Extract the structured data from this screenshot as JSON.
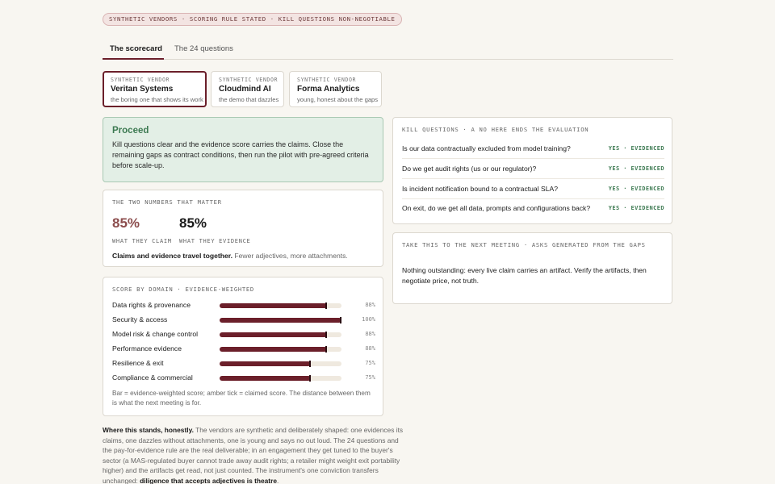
{
  "banner": "SYNTHETIC VENDORS · SCORING RULE STATED · KILL QUESTIONS NON-NEGOTIABLE",
  "tabs": [
    {
      "label": "The scorecard",
      "active": true
    },
    {
      "label": "The 24 questions",
      "active": false
    }
  ],
  "vendors": [
    {
      "tag": "SYNTHETIC VENDOR",
      "name": "Veritan Systems",
      "sub": "the boring one that shows its work",
      "active": true
    },
    {
      "tag": "SYNTHETIC VENDOR",
      "name": "Cloudmind AI",
      "sub": "the demo that dazzles",
      "active": false
    },
    {
      "tag": "SYNTHETIC VENDOR",
      "name": "Forma Analytics",
      "sub": "young, honest about the gaps",
      "active": false
    }
  ],
  "verdict": {
    "title": "Proceed",
    "text": "Kill questions clear and the evidence score carries the claims. Close the remaining gaps as contract conditions, then run the pilot with pre-agreed criteria before scale-up."
  },
  "numbers": {
    "label": "THE TWO NUMBERS THAT MATTER",
    "claim_value": "85%",
    "claim_label": "WHAT THEY CLAIM",
    "evidence_value": "85%",
    "evidence_label": "WHAT THEY EVIDENCE",
    "note_bold": "Claims and evidence travel together.",
    "note_rest": " Fewer adjectives, more attachments."
  },
  "domains": {
    "label": "SCORE BY DOMAIN · EVIDENCE-WEIGHTED",
    "items": [
      {
        "name": "Data rights & provenance",
        "pct": "88%",
        "evidence": 88,
        "claimed": 88
      },
      {
        "name": "Security & access",
        "pct": "100%",
        "evidence": 100,
        "claimed": 100
      },
      {
        "name": "Model risk & change control",
        "pct": "88%",
        "evidence": 88,
        "claimed": 88
      },
      {
        "name": "Performance evidence",
        "pct": "88%",
        "evidence": 88,
        "claimed": 88
      },
      {
        "name": "Resilience & exit",
        "pct": "75%",
        "evidence": 75,
        "claimed": 75
      },
      {
        "name": "Compliance & commercial",
        "pct": "75%",
        "evidence": 75,
        "claimed": 75
      }
    ],
    "note": "Bar = evidence-weighted score; amber tick = claimed score. The distance between them is what the next meeting is for."
  },
  "honest": {
    "lead": "Where this stands, honestly.",
    "body": " The vendors are synthetic and deliberately shaped: one evidences its claims, one dazzles without attachments, one is young and says no out loud. The 24 questions and the pay-for-evidence rule are the real deliverable; in an engagement they get tuned to the buyer's sector (a MAS-regulated buyer cannot trade away audit rights; a retailer might weight exit portability higher) and the artifacts get read, not just counted. The instrument's one conviction transfers unchanged: ",
    "tail": "diligence that accepts adjectives is theatre",
    "end": "."
  },
  "kill": {
    "label": "KILL QUESTIONS · A NO HERE ENDS THE EVALUATION",
    "items": [
      {
        "q": "Is our data contractually excluded from model training?",
        "a": "YES · EVIDENCED"
      },
      {
        "q": "Do we get audit rights (us or our regulator)?",
        "a": "YES · EVIDENCED"
      },
      {
        "q": "Is incident notification bound to a contractual SLA?",
        "a": "YES · EVIDENCED"
      },
      {
        "q": "On exit, do we get all data, prompts and configurations back?",
        "a": "YES · EVIDENCED"
      }
    ]
  },
  "asks": {
    "label": "TAKE THIS TO THE NEXT MEETING · ASKS GENERATED FROM THE GAPS",
    "text": "Nothing outstanding: every live claim carries an artifact. Verify the artifacts, then negotiate price, not truth."
  },
  "colors": {
    "accent": "#6b1f2a",
    "proceed": "#3d7a52",
    "evidence": "#3d7a52"
  }
}
